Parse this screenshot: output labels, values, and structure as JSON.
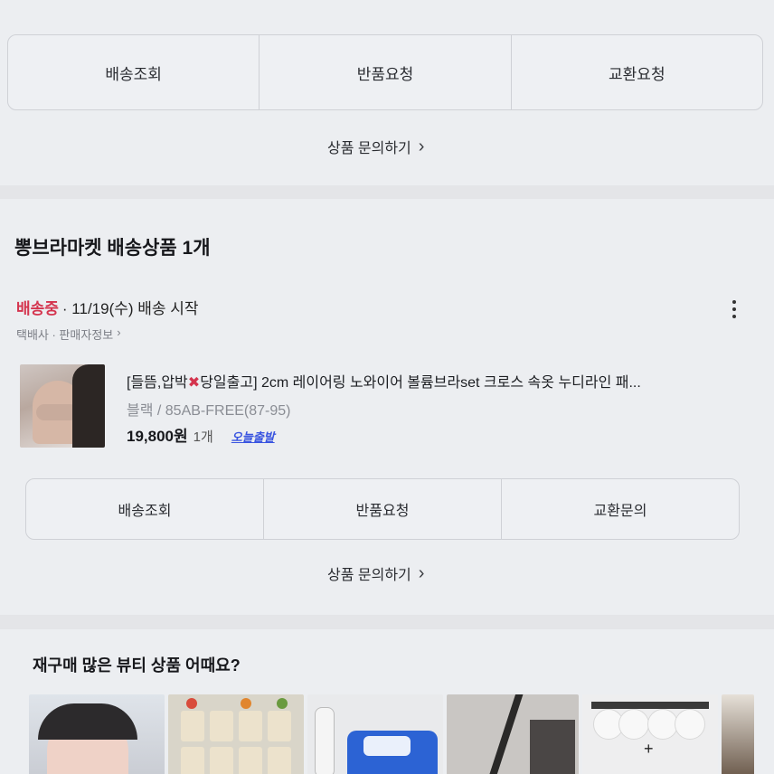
{
  "top_actions": {
    "buttons": [
      "배송조회",
      "반품요청",
      "교환요청"
    ],
    "inquiry_label": "상품 문의하기"
  },
  "order": {
    "store_title": "뽕브라마켓 배송상품 1개",
    "status": "배송중",
    "schedule": "· 11/19(수) 배송 시작",
    "seller_links": "택배사 · 판매자정보",
    "product": {
      "name_prefix": "[들뜸,압박",
      "name_suffix": "당일출고] 2cm 레이어링 노와이어 볼륨브라set 크로스 속옷 누디라인 패...",
      "option": "블랙 / 85AB-FREE(87-95)",
      "price": "19,800원",
      "quantity": "1개",
      "badge": "오늘출발"
    },
    "buttons": [
      "배송조회",
      "반품요청",
      "교환문의"
    ],
    "inquiry_label": "상품 문의하기"
  },
  "recommendations": {
    "title": "재구매 많은 뷰티 상품 어때요?"
  },
  "icons": {
    "chevron": "chevron-right-icon",
    "more": "more-vertical-icon",
    "cross": "cross-mark-icon"
  },
  "colors": {
    "status": "#d4344e",
    "badge": "#3a55e0",
    "background": "#eceef1"
  }
}
